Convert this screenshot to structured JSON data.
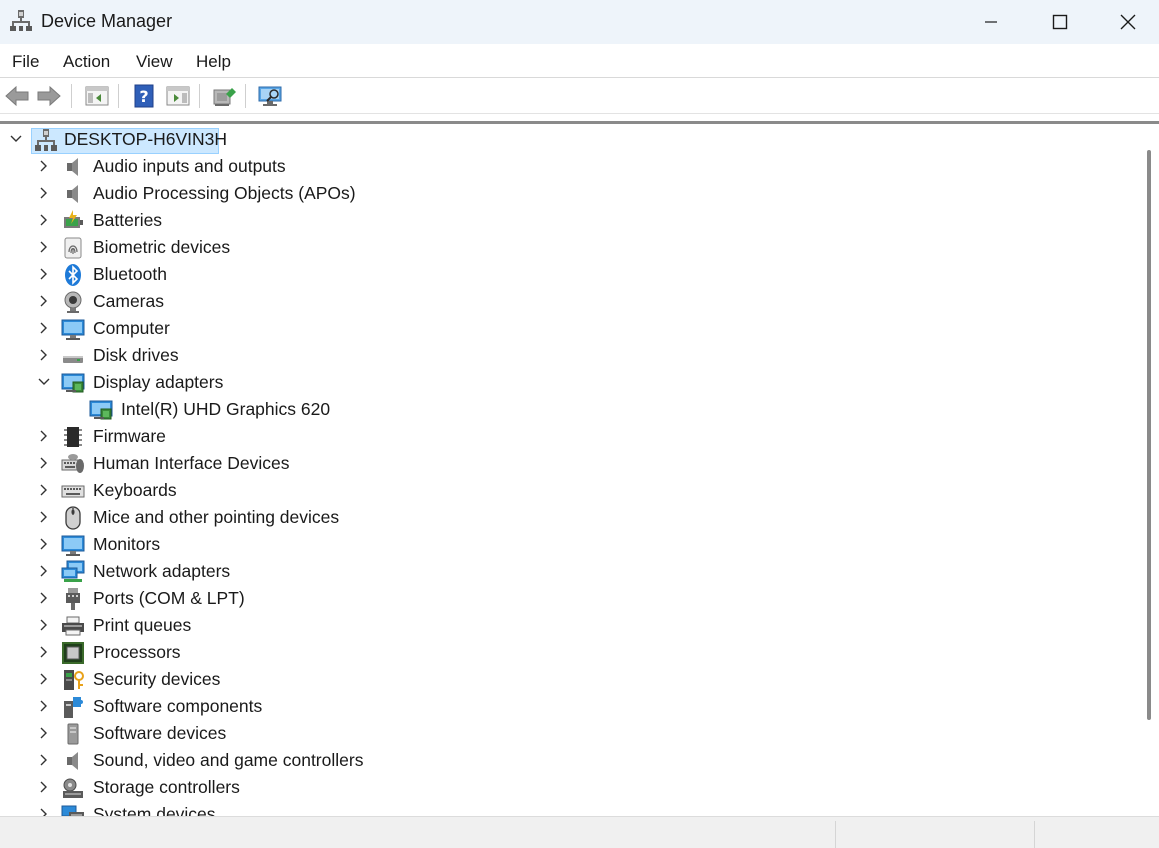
{
  "window": {
    "title": "Device Manager"
  },
  "menu": {
    "items": [
      "File",
      "Action",
      "View",
      "Help"
    ]
  },
  "toolbar": {
    "buttons": [
      "back-arrow-icon",
      "forward-arrow-icon",
      "show-hide-console-tree-icon",
      "help-icon",
      "properties-pane-icon",
      "update-driver-icon",
      "scan-hardware-icon"
    ]
  },
  "tree": {
    "root": "DESKTOP-H6VIN3H",
    "items": [
      {
        "label": "Audio inputs and outputs",
        "icon": "speaker-icon",
        "expanded": false
      },
      {
        "label": "Audio Processing Objects (APOs)",
        "icon": "speaker-icon",
        "expanded": false
      },
      {
        "label": "Batteries",
        "icon": "battery-icon",
        "expanded": false
      },
      {
        "label": "Biometric devices",
        "icon": "fingerprint-icon",
        "expanded": false
      },
      {
        "label": "Bluetooth",
        "icon": "bluetooth-icon",
        "expanded": false
      },
      {
        "label": "Cameras",
        "icon": "camera-icon",
        "expanded": false
      },
      {
        "label": "Computer",
        "icon": "monitor-icon",
        "expanded": false
      },
      {
        "label": "Disk drives",
        "icon": "disk-drive-icon",
        "expanded": false
      },
      {
        "label": "Display adapters",
        "icon": "display-adapter-icon",
        "expanded": true
      },
      {
        "label": "Intel(R) UHD Graphics 620",
        "icon": "display-adapter-icon",
        "child": true
      },
      {
        "label": "Firmware",
        "icon": "chip-icon",
        "expanded": false
      },
      {
        "label": "Human Interface Devices",
        "icon": "hid-icon",
        "expanded": false
      },
      {
        "label": "Keyboards",
        "icon": "keyboard-icon",
        "expanded": false
      },
      {
        "label": "Mice and other pointing devices",
        "icon": "mouse-icon",
        "expanded": false
      },
      {
        "label": "Monitors",
        "icon": "monitor-icon",
        "expanded": false
      },
      {
        "label": "Network adapters",
        "icon": "network-icon",
        "expanded": false
      },
      {
        "label": "Ports (COM & LPT)",
        "icon": "port-icon",
        "expanded": false
      },
      {
        "label": "Print queues",
        "icon": "printer-icon",
        "expanded": false
      },
      {
        "label": "Processors",
        "icon": "processor-icon",
        "expanded": false
      },
      {
        "label": "Security devices",
        "icon": "security-key-icon",
        "expanded": false
      },
      {
        "label": "Software components",
        "icon": "puzzle-icon",
        "expanded": false
      },
      {
        "label": "Software devices",
        "icon": "software-device-icon",
        "expanded": false
      },
      {
        "label": "Sound, video and game controllers",
        "icon": "speaker-icon",
        "expanded": false
      },
      {
        "label": "Storage controllers",
        "icon": "storage-controller-icon",
        "expanded": false
      },
      {
        "label": "System devices",
        "icon": "system-devices-icon",
        "expanded": false
      }
    ]
  },
  "colors": {
    "titlebar_bg": "#eef4fa",
    "selection_bg": "#cce8ff",
    "selection_border": "#99d1ff"
  }
}
